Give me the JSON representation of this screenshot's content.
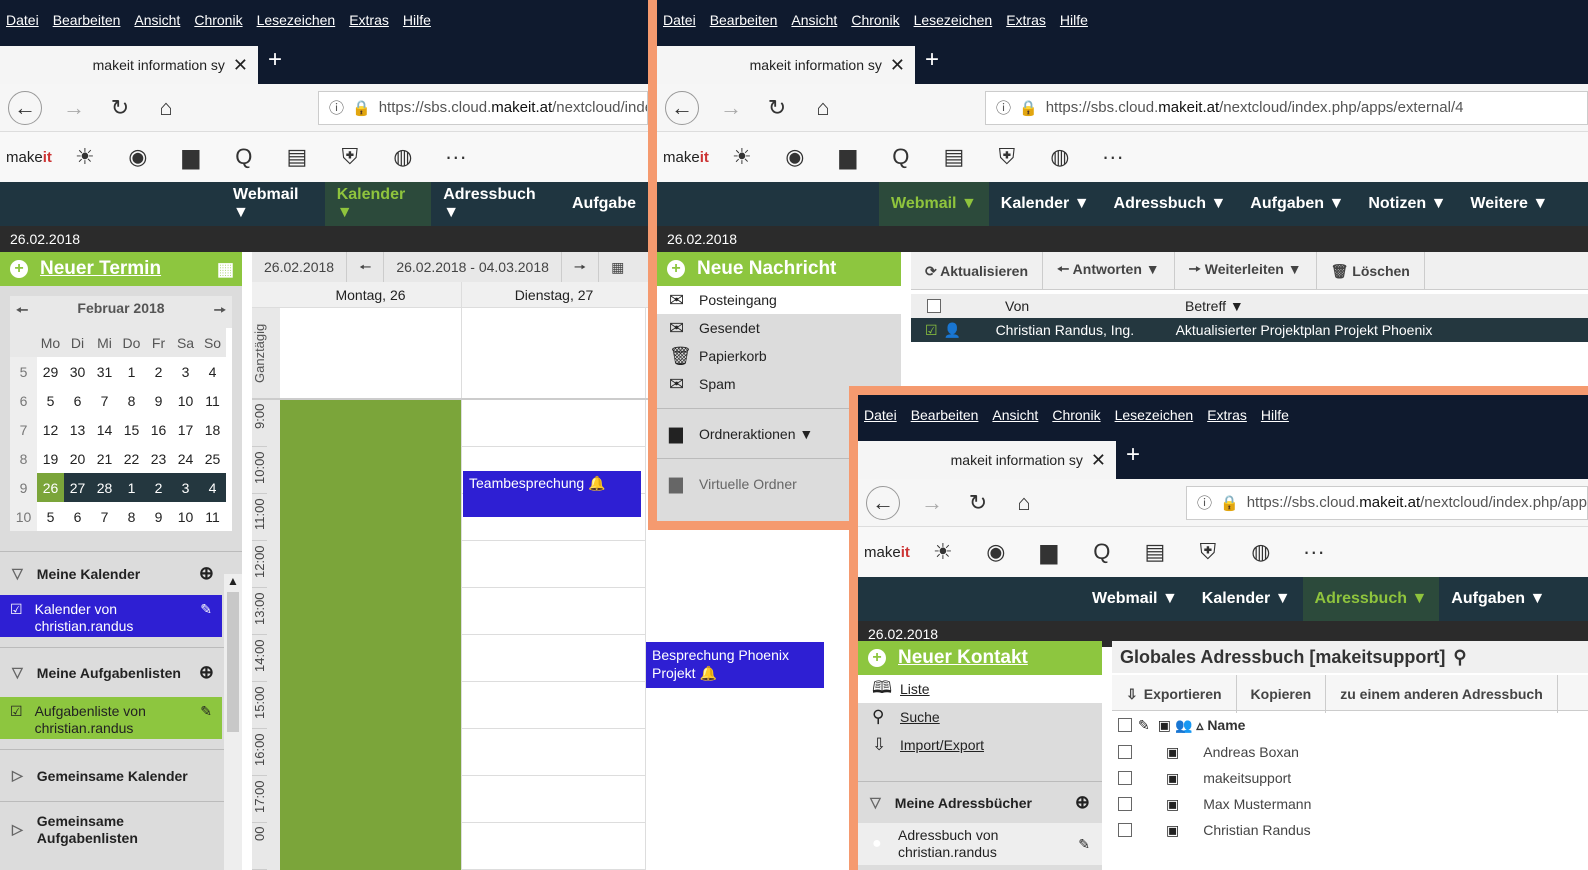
{
  "menu": [
    "Datei",
    "Bearbeiten",
    "Ansicht",
    "Chronik",
    "Lesezeichen",
    "Extras",
    "Hilfe"
  ],
  "tab_title": "makeit information sy",
  "tab_close": "✕",
  "tab_plus": "+",
  "nav": {
    "back": "←",
    "forward": "→",
    "reload": "↻",
    "home": "⌂"
  },
  "urls": {
    "w1": {
      "pre": "https://sbs.cloud.",
      "bold": "makeit.at",
      "post": "/nextcloud/index."
    },
    "w2": {
      "pre": "https://sbs.cloud.",
      "bold": "makeit.at",
      "post": "/nextcloud/index.php/apps/external/4"
    },
    "w3": {
      "pre": "https://sbs.cloud.",
      "bold": "makeit.at",
      "post": "/nextcloud/index.php/app"
    }
  },
  "logo": {
    "a": "make",
    "b": "it"
  },
  "appicons": [
    "☀",
    "◉",
    "▆",
    "Q",
    "▤",
    "⛨",
    "◍",
    "···"
  ],
  "date": "26.02.2018",
  "w1": {
    "nav": [
      "Webmail ▼",
      "Kalender ▼",
      "Adressbuch ▼",
      "Aufgabe"
    ],
    "new_btn": "Neuer Termin",
    "mini_month": "Februar 2018",
    "weekdays": [
      "Mo",
      "Di",
      "Mi",
      "Do",
      "Fr",
      "Sa",
      "So"
    ],
    "weeks": [
      [
        "5",
        "29",
        "30",
        "31",
        "1",
        "2",
        "3",
        "4"
      ],
      [
        "6",
        "5",
        "6",
        "7",
        "8",
        "9",
        "10",
        "11"
      ],
      [
        "7",
        "12",
        "13",
        "14",
        "15",
        "16",
        "17",
        "18"
      ],
      [
        "8",
        "19",
        "20",
        "21",
        "22",
        "23",
        "24",
        "25"
      ],
      [
        "9",
        "26",
        "27",
        "28",
        "1",
        "2",
        "3",
        "4"
      ],
      [
        "10",
        "5",
        "6",
        "7",
        "8",
        "9",
        "10",
        "11"
      ]
    ],
    "toolbar_date": "26.02.2018",
    "toolbar_range": "26.02.2018 - 04.03.2018",
    "toolbar_prev": "🠔",
    "toolbar_next": "🠖",
    "col1": "Montag, 26",
    "col2": "Dienstag, 27",
    "allday": "Ganztägig",
    "hours": [
      "9:00",
      "10:00",
      "11:00",
      "12:00",
      "13:00",
      "14:00",
      "15:00",
      "16:00",
      "17:00",
      "00"
    ],
    "evt1": "Teambesprechung 🔔",
    "evt2": "Besprechung Phoenix Projekt 🔔",
    "sec_my_cal": "Meine Kalender",
    "cal_item": "Kalender von christian.randus",
    "sec_tasks": "Meine Aufgabenlisten",
    "task_item": "Aufgabenliste von christian.randus",
    "sec_shared_cal": "Gemeinsame Kalender",
    "sec_shared_tasks": "Gemeinsame Aufgabenlisten"
  },
  "w2": {
    "nav": [
      "Webmail ▼",
      "Kalender ▼",
      "Adressbuch ▼",
      "Aufgaben ▼",
      "Notizen ▼",
      "Weitere ▼"
    ],
    "new_btn": "Neue Nachricht",
    "folders": [
      "Posteingang",
      "Gesendet",
      "Papierkorb",
      "Spam"
    ],
    "folder_icons": [
      "✉",
      "✉",
      "🗑",
      "✉"
    ],
    "folder_actions": "Ordneraktionen ▼",
    "virtual": "Virtuelle Ordner",
    "tools": [
      "⟳ Aktualisieren",
      "🠔 Antworten ▼",
      "🠖 Weiterleiten ▼",
      "🗑 Löschen"
    ],
    "col_from": "Von",
    "col_subject": "Betreff ▼",
    "mail_from": "Christian Randus, Ing.",
    "mail_subject": "Aktualisierter Projektplan Projekt Phoenix"
  },
  "w3": {
    "nav": [
      "Webmail ▼",
      "Kalender ▼",
      "Adressbuch ▼",
      "Aufgaben ▼"
    ],
    "new_btn": "Neuer Kontakt",
    "links": [
      "Liste",
      "Suche",
      "Import/Export"
    ],
    "link_icons": [
      "🕮",
      "⚲",
      "⇩"
    ],
    "sec_books": "Meine Adressbücher",
    "book_item": "Adressbuch von christian.randus",
    "title": "Globales Adressbuch [makeitsupport]",
    "tools": [
      "Exportieren",
      "Kopieren",
      "zu einem anderen Adressbuch"
    ],
    "col_name": "▵ Name",
    "contacts": [
      "Andreas Boxan",
      "makeitsupport",
      "Max Mustermann",
      "Christian Randus"
    ]
  }
}
